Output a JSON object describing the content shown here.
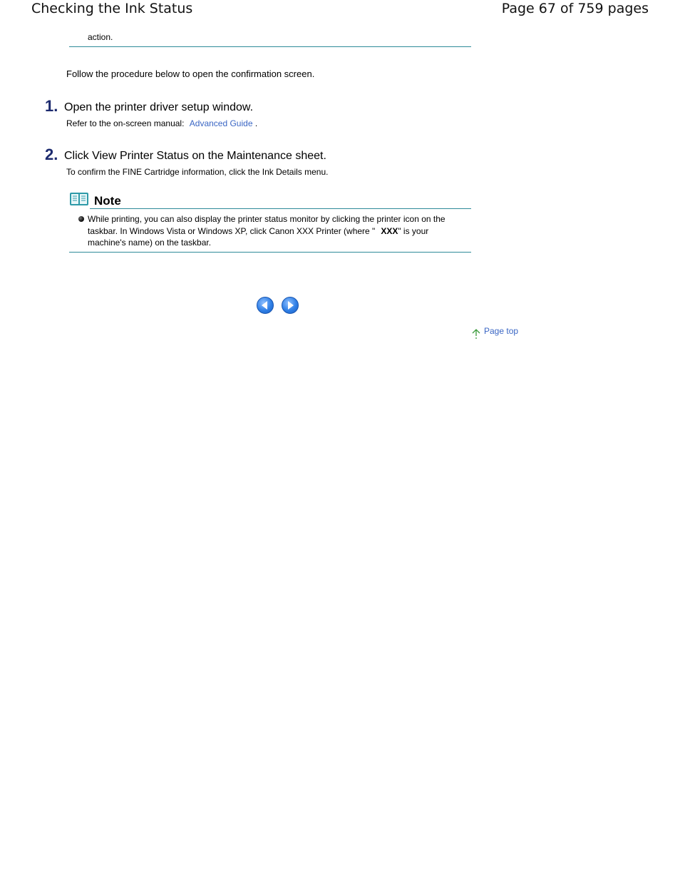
{
  "header": {
    "title": "Checking the Ink Status",
    "page_info": "Page 67 of 759 pages"
  },
  "intro": {
    "continued_text": "action.",
    "follow_text": "Follow the procedure below to open the confirmation screen."
  },
  "steps": [
    {
      "number": "1.",
      "title": "Open the printer driver setup window.",
      "desc_prefix": "Refer to the on-screen manual:",
      "link_text": "Advanced Guide",
      "desc_suffix": "."
    },
    {
      "number": "2.",
      "title": "Click View Printer Status on the Maintenance sheet.",
      "desc": "To confirm the FINE Cartridge information, click the Ink Details menu."
    }
  ],
  "note": {
    "heading": "Note",
    "line1": "While printing, you can also display the printer status monitor by clicking the printer icon on the",
    "line2_prefix": "taskbar. In Windows Vista or Windows XP, click Canon XXX Printer (where \"",
    "line2_bold": "XXX",
    "line2_suffix": "\" is your",
    "line3": "machine's name) on the taskbar."
  },
  "navigation": {
    "prev_icon": "previous-arrow-icon",
    "next_icon": "next-arrow-icon",
    "page_top_label": "Page top",
    "page_top_icon": "up-arrow-icon"
  },
  "colors": {
    "rule": "#2e8a99",
    "step_number": "#1c2a6e",
    "link": "#3a66c4",
    "nav_button": "#2f7fe6",
    "note_icon": "#2e9aa8"
  }
}
